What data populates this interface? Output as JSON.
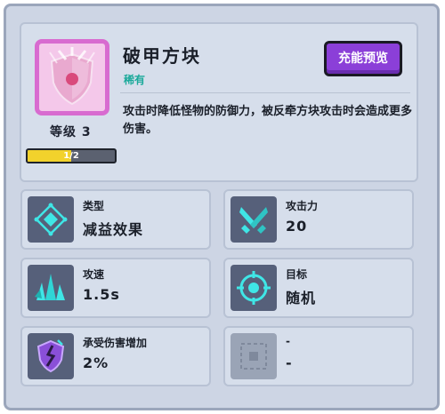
{
  "item": {
    "name": "破甲方块",
    "rarity": "稀有",
    "description": "攻击时降低怪物的防御力，被反牵方块攻击时会造成更多伤害。",
    "level_text": "等级 3",
    "progress_text": "1/2",
    "progress_fraction": 0.5,
    "preview_button": "充能预览"
  },
  "stats": [
    {
      "label": "类型",
      "value": "减益效果",
      "icon": "diamond-target-icon"
    },
    {
      "label": "攻击力",
      "value": "20",
      "icon": "crossed-swords-icon"
    },
    {
      "label": "攻速",
      "value": "1.5s",
      "icon": "spikes-icon"
    },
    {
      "label": "目标",
      "value": "随机",
      "icon": "crosshair-icon"
    },
    {
      "label": "承受伤害增加",
      "value": "2%",
      "icon": "broken-shield-icon"
    },
    {
      "label": "-",
      "value": "-",
      "icon": "empty-slot-icon"
    }
  ],
  "colors": {
    "rarity": "#1aa99a",
    "preview_button": "#8b3fd8",
    "progress_fill": "#f2d22c",
    "icon_frame": "#d86bd0"
  }
}
